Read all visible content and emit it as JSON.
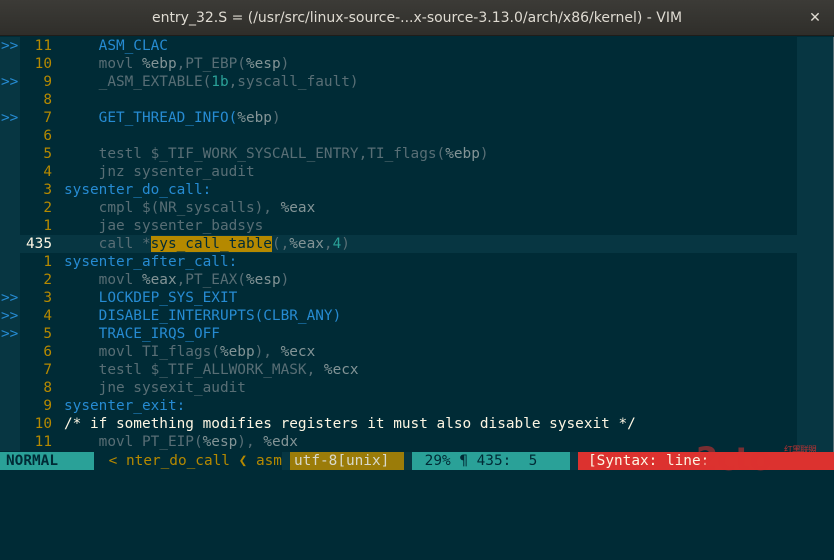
{
  "window": {
    "title": "entry_32.S = (/usr/src/linux-source-...x-source-3.13.0/arch/x86/kernel) - VIM",
    "close_glyph": "✕"
  },
  "editor": {
    "lines": [
      {
        "sign": ">>",
        "num": "11",
        "current": false,
        "tokens": [
          {
            "t": "    ASM_CLAC",
            "c": "fn"
          }
        ]
      },
      {
        "sign": "",
        "num": "10",
        "current": false,
        "tokens": [
          {
            "t": "    movl ",
            "c": ""
          },
          {
            "t": "%ebp",
            "c": "reg"
          },
          {
            "t": ",PT_EBP(",
            "c": ""
          },
          {
            "t": "%esp",
            "c": "reg"
          },
          {
            "t": ")",
            "c": ""
          }
        ]
      },
      {
        "sign": ">>",
        "num": "9",
        "current": false,
        "tokens": [
          {
            "t": "    _ASM_EXTABLE(",
            "c": ""
          },
          {
            "t": "1b",
            "c": "num"
          },
          {
            "t": ",syscall_fault)",
            "c": ""
          }
        ]
      },
      {
        "sign": "",
        "num": "8",
        "current": false,
        "tokens": []
      },
      {
        "sign": ">>",
        "num": "7",
        "current": false,
        "tokens": [
          {
            "t": "    GET_THREAD_INFO(",
            "c": "fn"
          },
          {
            "t": "%ebp",
            "c": "reg"
          },
          {
            "t": ")",
            "c": ""
          }
        ]
      },
      {
        "sign": "",
        "num": "6",
        "current": false,
        "tokens": []
      },
      {
        "sign": "",
        "num": "5",
        "current": false,
        "tokens": [
          {
            "t": "    testl $_TIF_WORK_SYSCALL_ENTRY,TI_flags(",
            "c": ""
          },
          {
            "t": "%ebp",
            "c": "reg"
          },
          {
            "t": ")",
            "c": ""
          }
        ]
      },
      {
        "sign": "",
        "num": "4",
        "current": false,
        "tokens": [
          {
            "t": "    jnz sysenter_audit",
            "c": ""
          }
        ]
      },
      {
        "sign": "",
        "num": "3",
        "current": false,
        "tokens": [
          {
            "t": "sysenter_do_call:",
            "c": "label"
          }
        ]
      },
      {
        "sign": "",
        "num": "2",
        "current": false,
        "tokens": [
          {
            "t": "    cmpl $(NR_syscalls), ",
            "c": ""
          },
          {
            "t": "%eax",
            "c": "reg"
          }
        ]
      },
      {
        "sign": "",
        "num": "1",
        "current": false,
        "tokens": [
          {
            "t": "    jae sysenter_badsys",
            "c": ""
          }
        ]
      },
      {
        "sign": "",
        "num": "435",
        "current": true,
        "tokens": [
          {
            "t": "    call *",
            "c": ""
          },
          {
            "t": "sys_call_table",
            "c": "hl"
          },
          {
            "t": "(,",
            "c": ""
          },
          {
            "t": "%eax",
            "c": "reg"
          },
          {
            "t": ",",
            "c": ""
          },
          {
            "t": "4",
            "c": "num"
          },
          {
            "t": ")",
            "c": ""
          }
        ]
      },
      {
        "sign": "",
        "num": "1",
        "current": false,
        "tokens": [
          {
            "t": "sysenter_after_call:",
            "c": "label"
          }
        ]
      },
      {
        "sign": "",
        "num": "2",
        "current": false,
        "tokens": [
          {
            "t": "    movl ",
            "c": ""
          },
          {
            "t": "%eax",
            "c": "reg"
          },
          {
            "t": ",PT_EAX(",
            "c": ""
          },
          {
            "t": "%esp",
            "c": "reg"
          },
          {
            "t": ")",
            "c": ""
          }
        ]
      },
      {
        "sign": ">>",
        "num": "3",
        "current": false,
        "tokens": [
          {
            "t": "    LOCKDEP_SYS_EXIT",
            "c": "fn"
          }
        ]
      },
      {
        "sign": ">>",
        "num": "4",
        "current": false,
        "tokens": [
          {
            "t": "    DISABLE_INTERRUPTS(CLBR_ANY)",
            "c": "fn"
          }
        ]
      },
      {
        "sign": ">>",
        "num": "5",
        "current": false,
        "tokens": [
          {
            "t": "    TRACE_IRQS_OFF",
            "c": "fn"
          }
        ]
      },
      {
        "sign": "",
        "num": "6",
        "current": false,
        "tokens": [
          {
            "t": "    movl TI_flags(",
            "c": ""
          },
          {
            "t": "%ebp",
            "c": "reg"
          },
          {
            "t": "), ",
            "c": ""
          },
          {
            "t": "%ecx",
            "c": "reg"
          }
        ]
      },
      {
        "sign": "",
        "num": "7",
        "current": false,
        "tokens": [
          {
            "t": "    testl $_TIF_ALLWORK_MASK, ",
            "c": ""
          },
          {
            "t": "%ecx",
            "c": "reg"
          }
        ]
      },
      {
        "sign": "",
        "num": "8",
        "current": false,
        "tokens": [
          {
            "t": "    jne sysexit_audit",
            "c": ""
          }
        ]
      },
      {
        "sign": "",
        "num": "9",
        "current": false,
        "tokens": [
          {
            "t": "sysenter_exit:",
            "c": "label"
          }
        ]
      },
      {
        "sign": "",
        "num": "10",
        "current": false,
        "tokens": [
          {
            "t": "/* if something modifies registers it must also disable sysexit */",
            "c": "cmt"
          }
        ]
      },
      {
        "sign": "",
        "num": "11",
        "current": false,
        "tokens": [
          {
            "t": "    movl PT_EIP(",
            "c": ""
          },
          {
            "t": "%esp",
            "c": "reg"
          },
          {
            "t": "), ",
            "c": ""
          },
          {
            "t": "%edx",
            "c": "reg"
          }
        ]
      }
    ]
  },
  "statusline": {
    "mode": "NORMAL",
    "branch": " < nter_do_call ❮ asm",
    "encoding": "utf-8[unix]",
    "position": " 29% ¶ 435:  5",
    "warning": "[Syntax: line:"
  },
  "watermark": {
    "text": "2cto",
    "sub": "红黑联盟"
  }
}
